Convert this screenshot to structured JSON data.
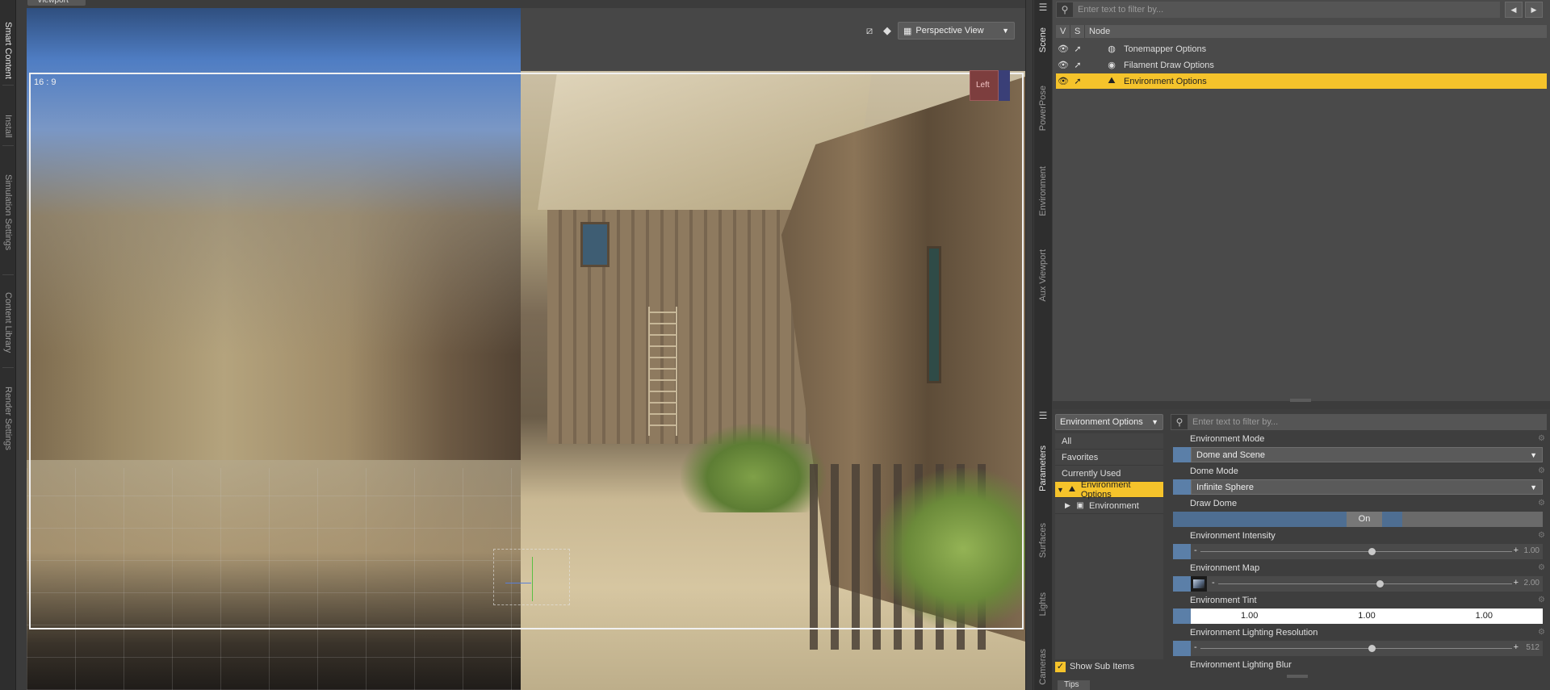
{
  "left_tabs": [
    "Smart Content",
    "Install",
    "Simulation Settings",
    "Content Library",
    "Render Settings"
  ],
  "viewport": {
    "tab_label": "Viewport",
    "camera": "Perspective View",
    "aspect_label": "16 : 9",
    "nav_cube_label": "Left"
  },
  "right_tabs_top": [
    "Scene",
    "PowerPose",
    "Environment",
    "Aux Viewport"
  ],
  "right_tabs_bottom": [
    "Parameters",
    "Surfaces",
    "Lights",
    "Cameras"
  ],
  "scene": {
    "filter_placeholder": "Enter text to filter by...",
    "columns": [
      "V",
      "S",
      "Node"
    ],
    "nodes": [
      {
        "label": "Tonemapper Options",
        "icon": "tonemapper-icon",
        "selected": false
      },
      {
        "label": "Filament Draw Options",
        "icon": "filament-icon",
        "selected": false
      },
      {
        "label": "Environment Options",
        "icon": "environment-icon",
        "selected": true
      }
    ]
  },
  "parameters": {
    "node_select": "Environment Options",
    "filter_placeholder": "Enter text to filter by...",
    "groups": [
      {
        "label": "All"
      },
      {
        "label": "Favorites"
      },
      {
        "label": "Currently Used"
      },
      {
        "label": "Environment Options",
        "selected": true
      },
      {
        "label": "Environment"
      }
    ],
    "show_sub_items": "Show Sub Items",
    "items": {
      "env_mode": {
        "label": "Environment Mode",
        "value": "Dome and Scene"
      },
      "dome_mode": {
        "label": "Dome Mode",
        "value": "Infinite Sphere"
      },
      "draw_dome": {
        "label": "Draw Dome",
        "value": "On"
      },
      "env_intensity": {
        "label": "Environment Intensity",
        "value": "1.00",
        "position": 0.55
      },
      "env_map": {
        "label": "Environment Map",
        "value": "2.00",
        "position": 0.55
      },
      "env_tint": {
        "label": "Environment Tint",
        "r": "1.00",
        "g": "1.00",
        "b": "1.00"
      },
      "env_light_res": {
        "label": "Environment Lighting Resolution",
        "value": "512",
        "position": 0.55
      },
      "env_light_blur": {
        "label": "Environment Lighting Blur"
      }
    }
  },
  "tips_label": "Tips",
  "colors": {
    "selection": "#f5c32b",
    "param_accent": "#5b7fa8"
  }
}
